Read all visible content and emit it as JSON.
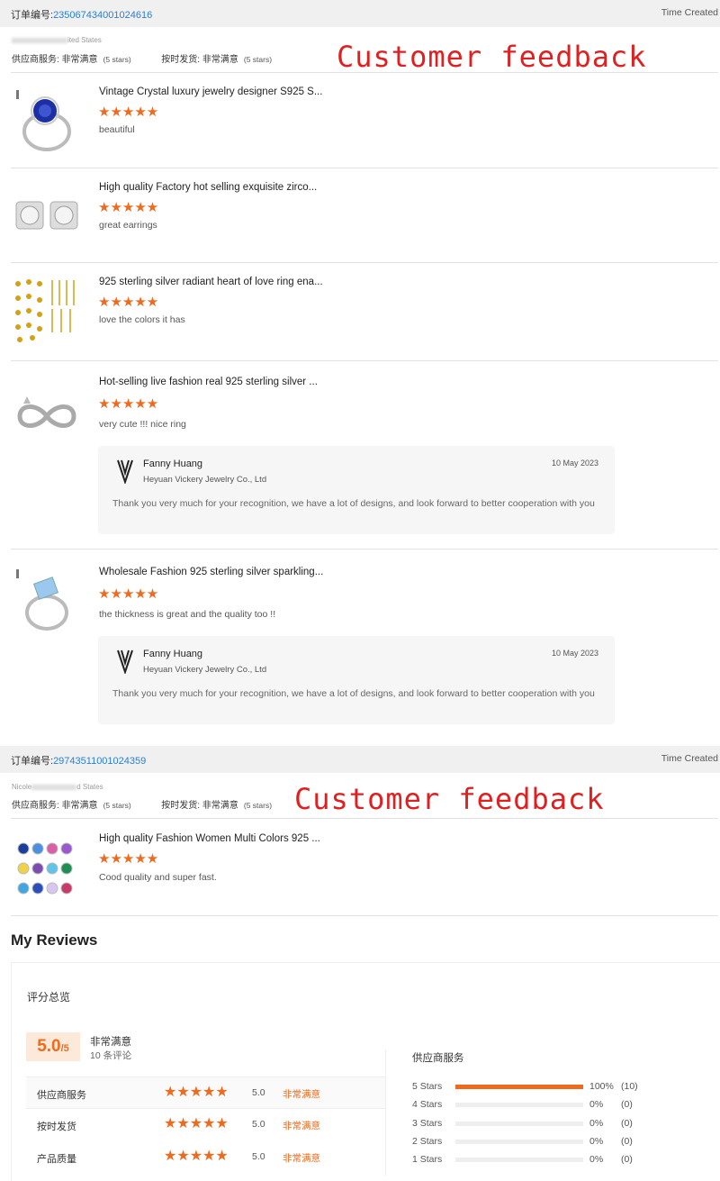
{
  "orders": [
    {
      "label": "订单编号:",
      "number": "2350674340010246 16",
      "time_label": "Time Created",
      "buyer_suffix": "ited States",
      "supplier_service": "供应商服务:",
      "supplier_value": "非常满意",
      "supplier_stars": "(5 stars)",
      "delivery": "按时发货:",
      "delivery_value": "非常满意",
      "delivery_stars": "(5 stars)",
      "annotation": "Customer feedback"
    },
    {
      "label": "订单编号:",
      "number": "29743511001024359",
      "time_label": "Time Created",
      "buyer_prefix": "Nicole",
      "buyer_suffix": "d States",
      "supplier_service": "供应商服务:",
      "supplier_value": "非常满意",
      "supplier_stars": "(5 stars)",
      "delivery": "按时发货:",
      "delivery_value": "非常满意",
      "delivery_stars": "(5 stars)",
      "annotation": "Customer feedback"
    }
  ],
  "reviews": [
    {
      "title": "Vintage Crystal luxury jewelry designer S925 S...",
      "stars": "★★★★★",
      "feedback": "beautiful"
    },
    {
      "title": "High quality Factory hot selling exquisite zirco...",
      "stars": "★★★★★",
      "feedback": "great earrings"
    },
    {
      "title": "925 sterling silver radiant heart of love ring ena...",
      "stars": "★★★★★",
      "feedback": "love the colors it has"
    },
    {
      "title": "Hot-selling live fashion real 925 sterling silver ...",
      "stars": "★★★★★",
      "feedback": "very cute !!! nice ring"
    },
    {
      "title": "Wholesale Fashion 925 sterling silver sparkling...",
      "stars": "★★★★★",
      "feedback": "the thickness is great and the quality too !!"
    },
    {
      "title": "High quality Fashion Women Multi Colors 925 ...",
      "stars": "★★★★★",
      "feedback": "Cood quality and super fast."
    }
  ],
  "reply": {
    "name": "Fanny Huang",
    "company": "Heyuan Vickery Jewelry Co., Ltd",
    "date": "10 May 2023",
    "text": "Thank you very much for your recognition, we have a lot of designs, and look forward to better cooperation with you"
  },
  "my_reviews": {
    "title": "My Reviews",
    "overview": "评分总览",
    "score": "5.0",
    "score_max": "/5",
    "satisfaction": "非常满意",
    "count": "10 条评论",
    "rows": [
      {
        "label": "供应商服务",
        "stars": "★★★★★",
        "value": "5.0",
        "text": "非常满意"
      },
      {
        "label": "按时发货",
        "stars": "★★★★★",
        "value": "5.0",
        "text": "非常满意"
      },
      {
        "label": "产品质量",
        "stars": "★★★★★",
        "value": "5.0",
        "text": "非常满意"
      }
    ],
    "dist_title": "供应商服务",
    "distribution": [
      {
        "label": "5 Stars",
        "fraction": 1.0,
        "pct": "100%",
        "count": "(10)"
      },
      {
        "label": "4 Stars",
        "fraction": 0,
        "pct": "0%",
        "count": "(0)"
      },
      {
        "label": "3 Stars",
        "fraction": 0,
        "pct": "0%",
        "count": "(0)"
      },
      {
        "label": "2 Stars",
        "fraction": 0,
        "pct": "0%",
        "count": "(0)"
      },
      {
        "label": "1 Stars",
        "fraction": 0,
        "pct": "0%",
        "count": "(0)"
      }
    ]
  },
  "colors": {
    "accent": "#f06a1d",
    "link": "#2a7fd4",
    "annotation": "#e02020"
  }
}
